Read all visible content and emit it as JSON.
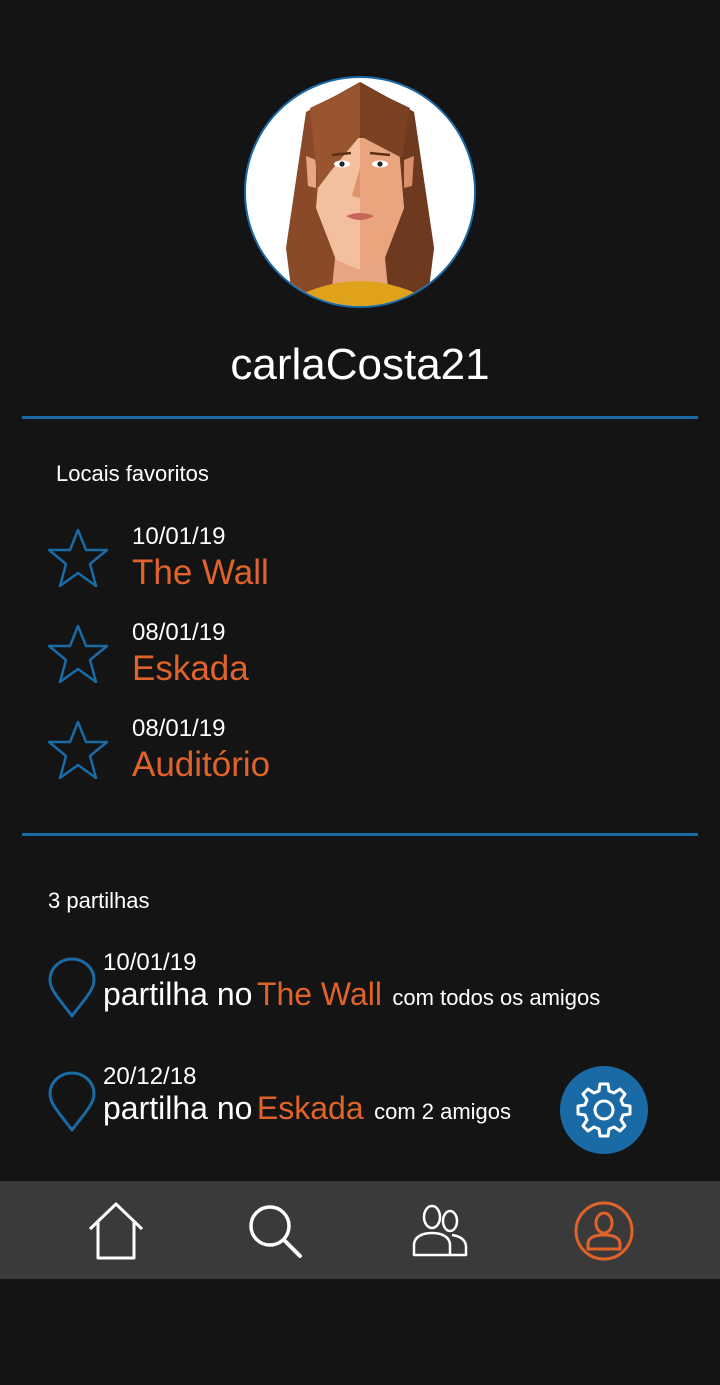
{
  "profile": {
    "username": "carlaCosta21"
  },
  "favorites": {
    "title": "Locais favoritos",
    "items": [
      {
        "date": "10/01/19",
        "place": "The Wall",
        "icon": "star-icon"
      },
      {
        "date": "08/01/19",
        "place": "Eskada",
        "icon": "star-icon"
      },
      {
        "date": "08/01/19",
        "place": "Auditório",
        "icon": "star-icon"
      }
    ]
  },
  "shares": {
    "title": "3 partilhas",
    "items": [
      {
        "date": "10/01/19",
        "prefix": "partilha no",
        "place": "The Wall",
        "suffix": "com todos os amigos",
        "icon": "location-pin-icon"
      },
      {
        "date": "20/12/18",
        "prefix": "partilha no",
        "place": "Eskada",
        "suffix": "com 2 amigos",
        "icon": "location-pin-icon"
      }
    ]
  },
  "actions": {
    "settings_icon": "gear-icon"
  },
  "navbar": {
    "items": [
      {
        "icon": "home-icon",
        "active": false
      },
      {
        "icon": "search-icon",
        "active": false
      },
      {
        "icon": "friends-icon",
        "active": false
      },
      {
        "icon": "profile-icon",
        "active": true
      }
    ]
  },
  "colors": {
    "background": "#141414",
    "accent_blue": "#1a6aa5",
    "accent_orange": "#e0632a",
    "navbar": "#3a3a3a"
  }
}
